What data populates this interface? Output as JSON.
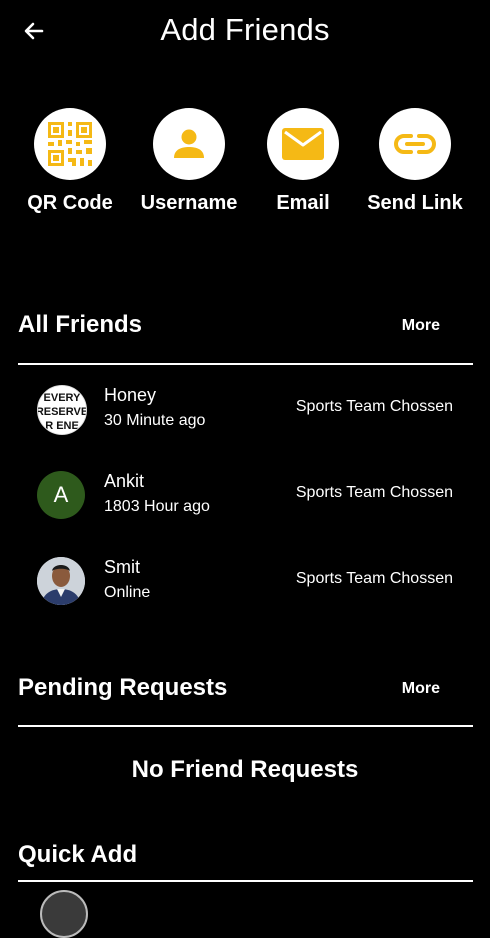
{
  "header": {
    "title": "Add Friends",
    "back_icon": "arrow-left-icon"
  },
  "actions": [
    {
      "label": "QR Code",
      "icon": "qr-code-icon"
    },
    {
      "label": "Username",
      "icon": "person-icon"
    },
    {
      "label": "Email",
      "icon": "mail-icon"
    },
    {
      "label": "Send Link",
      "icon": "link-icon"
    }
  ],
  "colors": {
    "background": "#000000",
    "accent": "#F5B915",
    "circle": "#FFFFFF",
    "avatar_green": "#2E5A1C"
  },
  "all_friends": {
    "title": "All Friends",
    "more_label": "More",
    "items": [
      {
        "name": "Honey",
        "subtitle": "30 Minute ago",
        "status": "Sports Team Chossen",
        "avatar": "image",
        "avatar_text": "EVERY RESERVE R ENE"
      },
      {
        "name": "Ankit",
        "subtitle": "1803 Hour ago",
        "status": "Sports Team Chossen",
        "avatar": "initial",
        "avatar_text": "A"
      },
      {
        "name": "Smit",
        "subtitle": "Online",
        "status": "Sports Team Chossen",
        "avatar": "photo"
      }
    ]
  },
  "pending_requests": {
    "title": "Pending Requests",
    "more_label": "More",
    "empty_text": "No Friend Requests"
  },
  "quick_add": {
    "title": "Quick Add"
  }
}
